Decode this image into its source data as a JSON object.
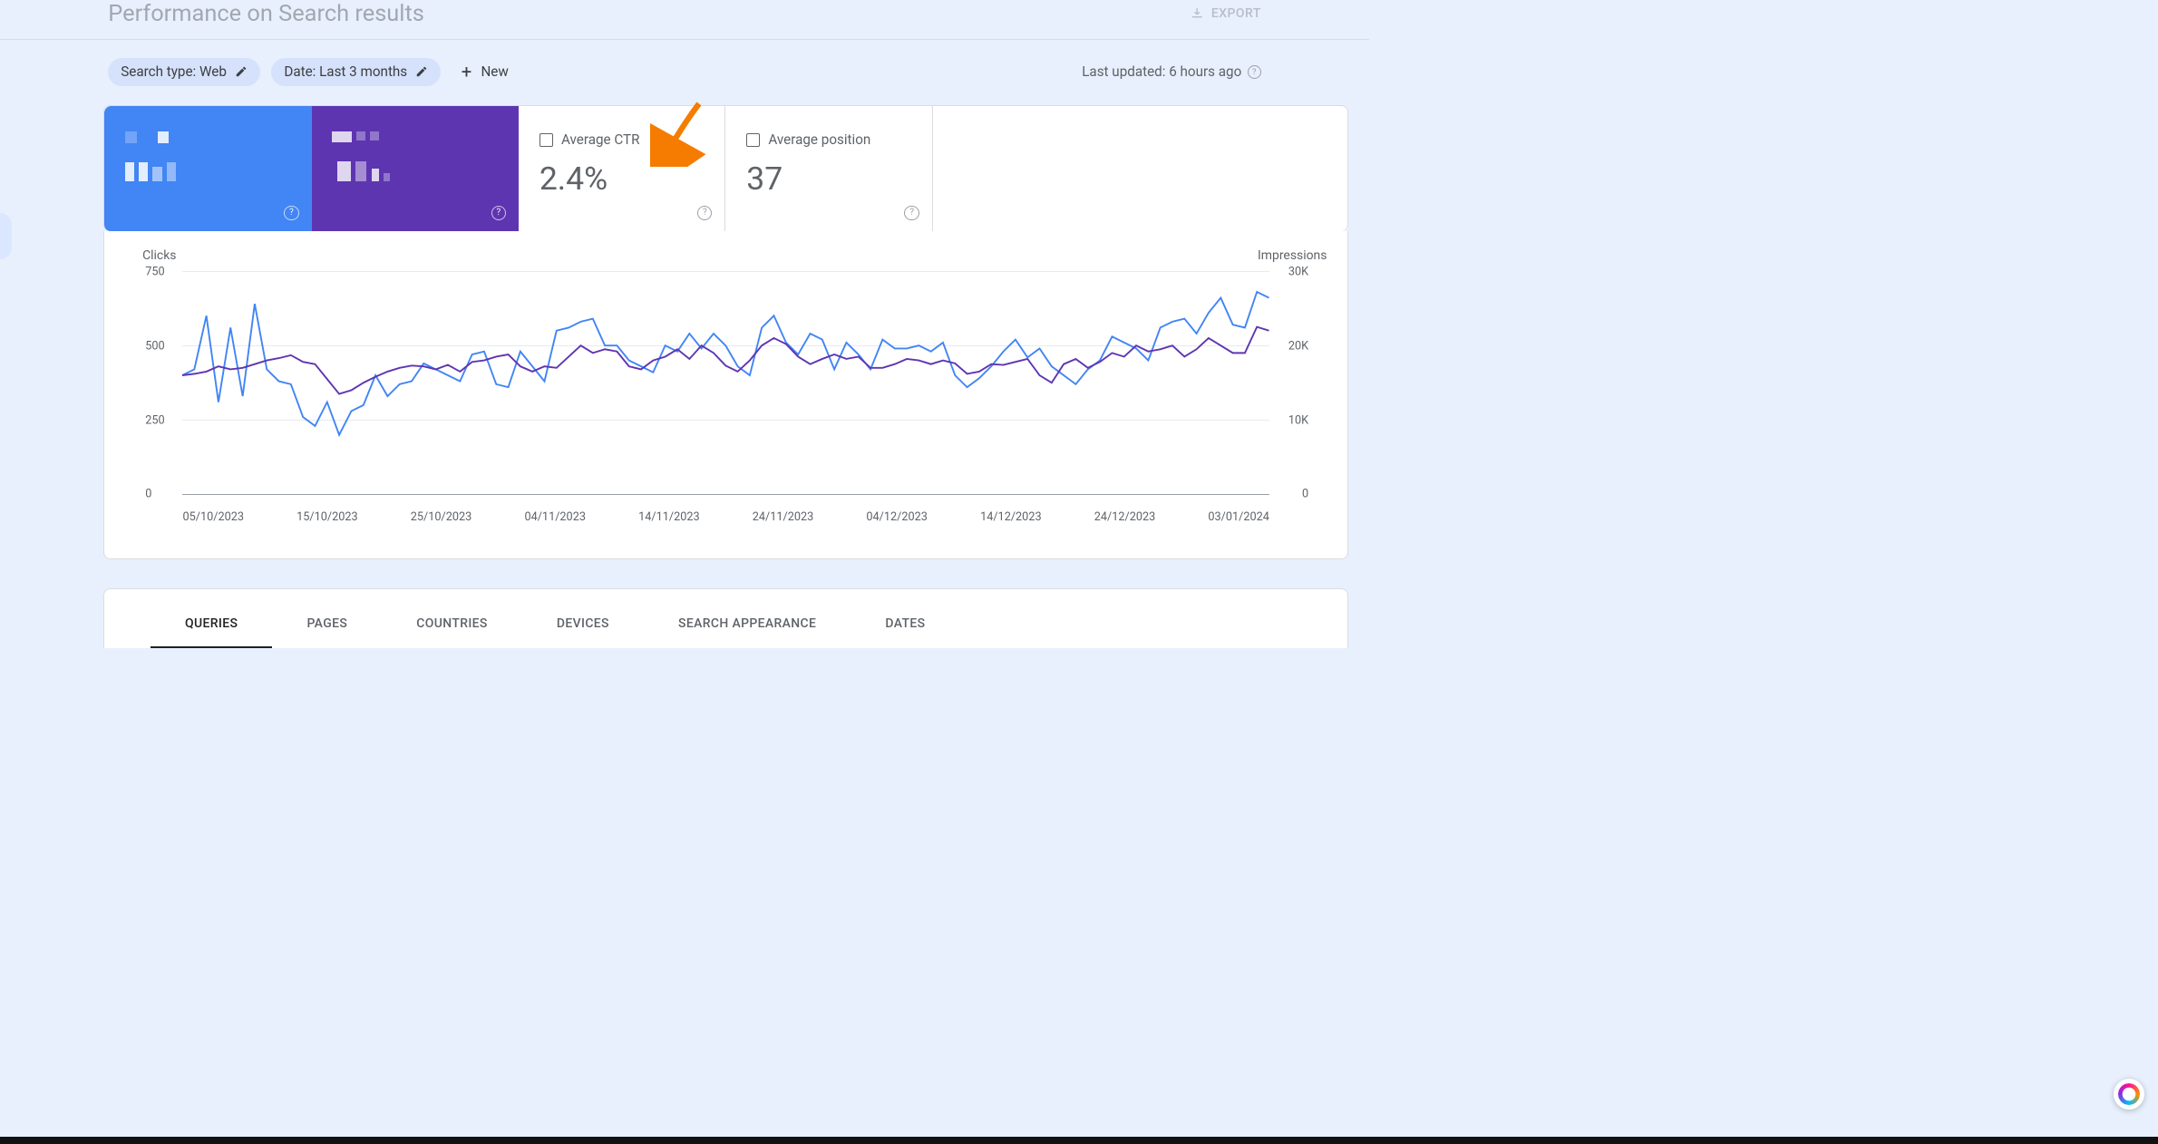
{
  "header": {
    "title": "Performance on Search results",
    "export_label": "EXPORT"
  },
  "filters": {
    "search_type": "Search type: Web",
    "date_filter": "Date: Last 3 months",
    "new_label": "New",
    "last_updated": "Last updated: 6 hours ago"
  },
  "metrics": {
    "ctr_label": "Average CTR",
    "ctr_value": "2.4%",
    "position_label": "Average position",
    "position_value": "37"
  },
  "chart": {
    "y_left_label": "Clicks",
    "y_right_label": "Impressions",
    "y_left_ticks": {
      "t0": "0",
      "t1": "250",
      "t2": "500",
      "t3": "750"
    },
    "y_right_ticks": {
      "t0": "0",
      "t1": "10K",
      "t2": "20K",
      "t3": "30K"
    },
    "x_ticks": [
      "05/10/2023",
      "15/10/2023",
      "25/10/2023",
      "04/11/2023",
      "14/11/2023",
      "24/11/2023",
      "04/12/2023",
      "14/12/2023",
      "24/12/2023",
      "03/01/2024"
    ]
  },
  "tabs": {
    "queries": "QUERIES",
    "pages": "PAGES",
    "countries": "COUNTRIES",
    "devices": "DEVICES",
    "search_appearance": "SEARCH APPEARANCE",
    "dates": "DATES"
  },
  "chart_data": {
    "type": "line",
    "xlabel": "",
    "left_axis": {
      "label": "Clicks",
      "ylim": [
        0,
        750
      ],
      "ticks": [
        0,
        250,
        500,
        750
      ]
    },
    "right_axis": {
      "label": "Impressions",
      "ylim": [
        0,
        30000
      ],
      "ticks": [
        0,
        10000,
        20000,
        30000
      ]
    },
    "x": [
      "05/10/2023",
      "06/10/2023",
      "07/10/2023",
      "08/10/2023",
      "09/10/2023",
      "10/10/2023",
      "11/10/2023",
      "12/10/2023",
      "13/10/2023",
      "14/10/2023",
      "15/10/2023",
      "16/10/2023",
      "17/10/2023",
      "18/10/2023",
      "19/10/2023",
      "20/10/2023",
      "21/10/2023",
      "22/10/2023",
      "23/10/2023",
      "24/10/2023",
      "25/10/2023",
      "26/10/2023",
      "27/10/2023",
      "28/10/2023",
      "29/10/2023",
      "30/10/2023",
      "31/10/2023",
      "01/11/2023",
      "02/11/2023",
      "03/11/2023",
      "04/11/2023",
      "05/11/2023",
      "06/11/2023",
      "07/11/2023",
      "08/11/2023",
      "09/11/2023",
      "10/11/2023",
      "11/11/2023",
      "12/11/2023",
      "13/11/2023",
      "14/11/2023",
      "15/11/2023",
      "16/11/2023",
      "17/11/2023",
      "18/11/2023",
      "19/11/2023",
      "20/11/2023",
      "21/11/2023",
      "22/11/2023",
      "23/11/2023",
      "24/11/2023",
      "25/11/2023",
      "26/11/2023",
      "27/11/2023",
      "28/11/2023",
      "29/11/2023",
      "30/11/2023",
      "01/12/2023",
      "02/12/2023",
      "03/12/2023",
      "04/12/2023",
      "05/12/2023",
      "06/12/2023",
      "07/12/2023",
      "08/12/2023",
      "09/12/2023",
      "10/12/2023",
      "11/12/2023",
      "12/12/2023",
      "13/12/2023",
      "14/12/2023",
      "15/12/2023",
      "16/12/2023",
      "17/12/2023",
      "18/12/2023",
      "19/12/2023",
      "20/12/2023",
      "21/12/2023",
      "22/12/2023",
      "23/12/2023",
      "24/12/2023",
      "25/12/2023",
      "26/12/2023",
      "27/12/2023",
      "28/12/2023",
      "29/12/2023",
      "30/12/2023",
      "31/12/2023",
      "01/01/2024",
      "02/01/2024",
      "03/01/2024"
    ],
    "series": [
      {
        "name": "Clicks",
        "axis": "left",
        "color": "#4285f4",
        "values": [
          400,
          420,
          600,
          310,
          560,
          330,
          640,
          420,
          380,
          370,
          260,
          230,
          310,
          200,
          280,
          300,
          400,
          330,
          370,
          380,
          440,
          420,
          400,
          380,
          470,
          480,
          370,
          360,
          480,
          430,
          380,
          550,
          560,
          580,
          590,
          500,
          500,
          450,
          430,
          410,
          500,
          480,
          540,
          490,
          540,
          500,
          430,
          400,
          560,
          600,
          510,
          470,
          540,
          520,
          420,
          510,
          470,
          420,
          520,
          490,
          490,
          500,
          480,
          510,
          400,
          360,
          390,
          430,
          480,
          520,
          460,
          490,
          430,
          400,
          370,
          420,
          450,
          530,
          510,
          490,
          450,
          560,
          580,
          590,
          540,
          610,
          660,
          570,
          560,
          680,
          660
        ]
      },
      {
        "name": "Impressions",
        "axis": "right",
        "color": "#5e35b1",
        "values": [
          16000,
          16200,
          16500,
          17200,
          16800,
          17000,
          17500,
          18000,
          18300,
          18700,
          17800,
          17500,
          15500,
          13500,
          14000,
          15000,
          15800,
          16500,
          17000,
          17300,
          17200,
          16800,
          17400,
          16500,
          17800,
          18000,
          18500,
          18800,
          17200,
          16500,
          17200,
          17000,
          18500,
          20000,
          19000,
          19500,
          19200,
          17200,
          16800,
          18000,
          18500,
          19500,
          18200,
          20000,
          19000,
          17300,
          16500,
          18000,
          20000,
          21000,
          20200,
          18500,
          17500,
          18200,
          18800,
          18200,
          18500,
          17000,
          17000,
          17500,
          18200,
          18000,
          17500,
          18000,
          17600,
          16200,
          16500,
          17500,
          17400,
          17800,
          18200,
          16000,
          15000,
          17500,
          18200,
          17000,
          17800,
          19000,
          18500,
          20000,
          19200,
          19500,
          20000,
          18500,
          19500,
          21000,
          20000,
          19000,
          19000,
          22500,
          22000
        ]
      }
    ]
  }
}
